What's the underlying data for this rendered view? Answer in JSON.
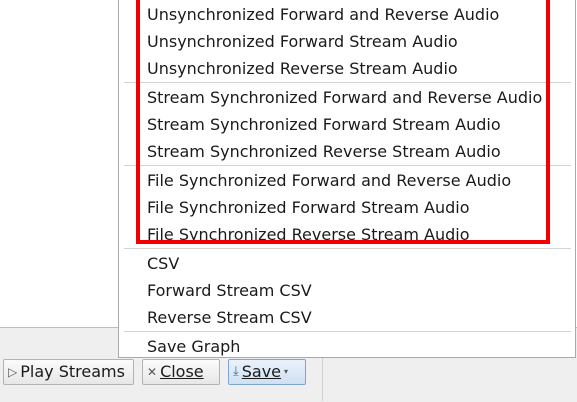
{
  "menu": {
    "groups": [
      {
        "items": [
          "Unsynchronized Forward and Reverse Audio",
          "Unsynchronized Forward Stream Audio",
          "Unsynchronized Reverse Stream Audio"
        ]
      },
      {
        "items": [
          "Stream Synchronized Forward and Reverse Audio",
          "Stream Synchronized Forward Stream Audio",
          "Stream Synchronized Reverse Stream Audio"
        ]
      },
      {
        "items": [
          "File Synchronized Forward and Reverse Audio",
          "File Synchronized Forward Stream Audio",
          "File Synchronized Reverse Stream Audio"
        ]
      },
      {
        "items": [
          "CSV",
          "Forward Stream CSV",
          "Reverse Stream CSV"
        ]
      },
      {
        "items": [
          "Save Graph"
        ]
      }
    ]
  },
  "buttons": {
    "play_streams": "Play Streams",
    "close": "Close",
    "save": "Save"
  },
  "highlight": {
    "color": "#f20000"
  }
}
